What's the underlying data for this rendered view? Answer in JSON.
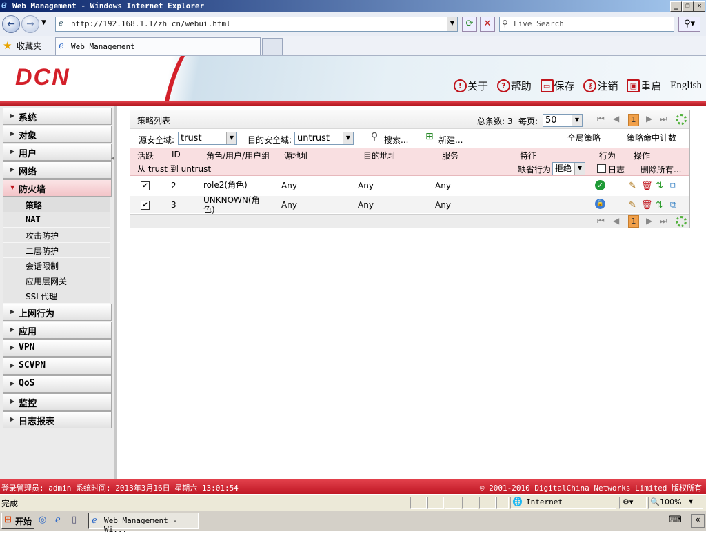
{
  "window": {
    "title": "Web Management - Windows Internet Explorer",
    "url": "http://192.168.1.1/zh_cn/webui.html",
    "search_placeholder": "Live Search",
    "favorites_label": "收藏夹",
    "tab_title": "Web Management"
  },
  "header": {
    "logo": "DCN",
    "links": [
      {
        "icon": "about-icon",
        "label": "关于"
      },
      {
        "icon": "help-icon",
        "label": "帮助"
      },
      {
        "icon": "save-icon",
        "label": "保存"
      },
      {
        "icon": "logout-icon",
        "label": "注销"
      },
      {
        "icon": "restart-icon",
        "label": "重启"
      }
    ],
    "language": "English"
  },
  "sidebar": {
    "menus": [
      {
        "label": "系统"
      },
      {
        "label": "对象"
      },
      {
        "label": "用户"
      },
      {
        "label": "网络"
      },
      {
        "label": "防火墙",
        "active": true
      }
    ],
    "firewall_sub": [
      "策略",
      "NAT",
      "攻击防护",
      "二层防护",
      "会话限制",
      "应用层网关",
      "SSL代理"
    ],
    "menus_after": [
      {
        "label": "上网行为"
      },
      {
        "label": "应用"
      },
      {
        "label": "VPN"
      },
      {
        "label": "SCVPN"
      },
      {
        "label": "QoS"
      },
      {
        "label": "监控"
      },
      {
        "label": "日志报表"
      }
    ]
  },
  "policy": {
    "title": "策略列表",
    "total_label": "总条数: 3",
    "per_page_label": "每页:",
    "per_page_value": "50",
    "current_page": "1",
    "src_zone_label": "源安全域:",
    "src_zone_value": "trust",
    "dst_zone_label": "目的安全域:",
    "dst_zone_value": "untrust",
    "search_label": "搜索...",
    "new_label": "新建...",
    "global_policy": "全局策略",
    "hit_count": "策略命中计数",
    "columns": [
      "活跃",
      "ID",
      "角色/用户/用户组",
      "源地址",
      "目的地址",
      "服务",
      "特征",
      "行为",
      "操作"
    ],
    "group_label": "从 trust 到 untrust",
    "default_action_label": "缺省行为",
    "default_action_value": "拒绝",
    "log_label": "日志",
    "delete_all_label": "删除所有...",
    "rows": [
      {
        "active": true,
        "id": "2",
        "role": "role2(角色)",
        "src": "Any",
        "dst": "Any",
        "service": "Any",
        "action": "permit"
      },
      {
        "active": true,
        "id": "3",
        "role": "UNKNOWN(角色)",
        "role_line1": "UNKNOWN(角",
        "role_line2": "色)",
        "src": "Any",
        "dst": "Any",
        "service": "Any",
        "action": "tunnel"
      }
    ]
  },
  "footer": {
    "left": "登录管理员: admin 系统时间: 2013年3月16日 星期六 13:01:54",
    "right": "© 2001-2010 DigitalChina Networks Limited 版权所有"
  },
  "ie_status": {
    "status": "完成",
    "zone": "Internet",
    "zoom": "100%"
  },
  "taskbar": {
    "start": "开始",
    "item": "Web Management - Wi..."
  },
  "colors": {
    "brand_red": "#c0141c",
    "header_row_pink": "#f9dfe1",
    "permit_green": "#1e9a36"
  }
}
